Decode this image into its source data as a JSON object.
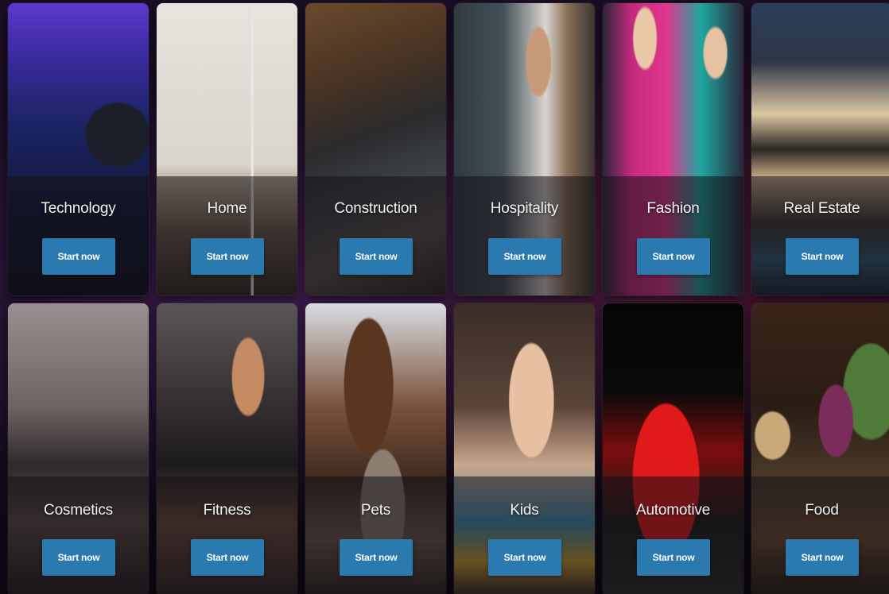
{
  "button_color": "#2a7ab0",
  "cards": [
    {
      "title": "Technology",
      "button": "Start now"
    },
    {
      "title": "Home",
      "button": "Start now"
    },
    {
      "title": "Construction",
      "button": "Start now"
    },
    {
      "title": "Hospitality",
      "button": "Start now"
    },
    {
      "title": "Fashion",
      "button": "Start now"
    },
    {
      "title": "Real Estate",
      "button": "Start now"
    },
    {
      "title": "Cosmetics",
      "button": "Start now"
    },
    {
      "title": "Fitness",
      "button": "Start now"
    },
    {
      "title": "Pets",
      "button": "Start now"
    },
    {
      "title": "Kids",
      "button": "Start now"
    },
    {
      "title": "Automotive",
      "button": "Start now"
    },
    {
      "title": "Food",
      "button": "Start now"
    }
  ]
}
